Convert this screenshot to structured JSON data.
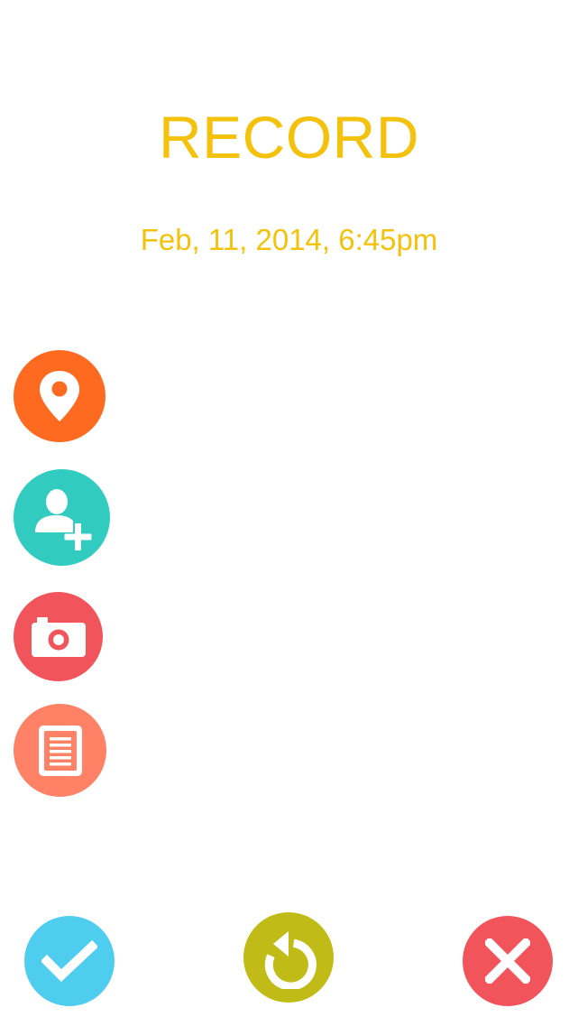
{
  "header": {
    "title": "RECORD",
    "timestamp": "Feb, 11, 2014, 6:45pm"
  },
  "colors": {
    "title": "#f4c20d",
    "location": "#ff6a21",
    "contact": "#31cbbf",
    "camera": "#f2545b",
    "note": "#ff8166",
    "confirm": "#4fcdef",
    "reset": "#c1bb17",
    "cancel": "#f2545b"
  },
  "side_actions": [
    {
      "id": "location",
      "icon": "map-pin-icon"
    },
    {
      "id": "contact",
      "icon": "add-person-icon"
    },
    {
      "id": "camera",
      "icon": "camera-icon"
    },
    {
      "id": "note",
      "icon": "note-icon"
    }
  ],
  "bottom_actions": [
    {
      "id": "confirm",
      "icon": "checkmark-icon"
    },
    {
      "id": "reset",
      "icon": "rotate-left-icon"
    },
    {
      "id": "cancel",
      "icon": "close-icon"
    }
  ]
}
